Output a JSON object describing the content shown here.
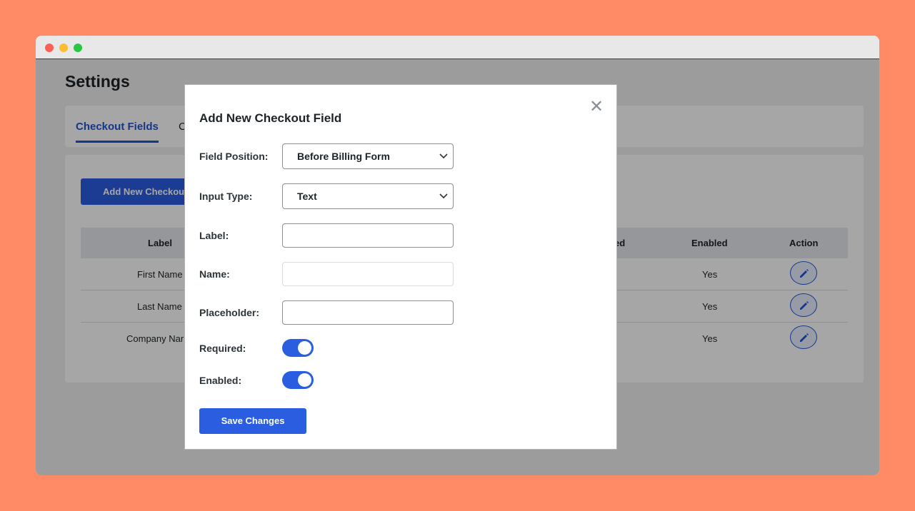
{
  "page": {
    "title": "Settings"
  },
  "tabs": [
    "Checkout Fields",
    "C"
  ],
  "main": {
    "add_button_label": "Add New Checkout Field",
    "table": {
      "headers": {
        "label": "Label",
        "required": "ed",
        "enabled": "Enabled",
        "action": "Action"
      },
      "rows": [
        {
          "label": "First Name",
          "enabled": "Yes"
        },
        {
          "label": "Last Name",
          "enabled": "Yes"
        },
        {
          "label": "Company Nar",
          "enabled": "Yes"
        }
      ]
    }
  },
  "modal": {
    "title": "Add New Checkout Field",
    "close_icon": "close-icon",
    "field_position": {
      "label": "Field Position:",
      "value": "Before Billing Form"
    },
    "input_type": {
      "label": "Input Type:",
      "value": "Text"
    },
    "label_field": {
      "label": "Label:",
      "value": ""
    },
    "name_field": {
      "label": "Name:",
      "value": ""
    },
    "placeholder_field": {
      "label": "Placeholder:",
      "value": ""
    },
    "required": {
      "label": "Required:",
      "on": true
    },
    "enabled": {
      "label": "Enabled:",
      "on": true
    },
    "save_label": "Save Changes"
  },
  "colors": {
    "accent": "#2a5de0",
    "background": "#ff8a66"
  }
}
